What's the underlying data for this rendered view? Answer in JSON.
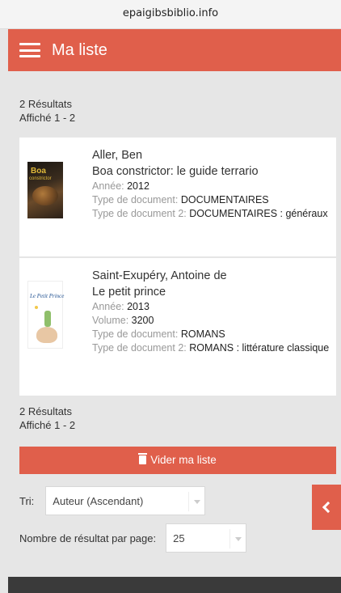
{
  "browser": {
    "url": "epaigibsbiblio.info"
  },
  "header": {
    "title": "Ma liste"
  },
  "results": {
    "count": "2 Résultats",
    "shown": "Affiché 1 - 2"
  },
  "items": [
    {
      "author": "Aller, Ben",
      "title": "Boa constrictor: le guide terrario",
      "annee_label": "Année:",
      "annee": "2012",
      "type_label": "Type de document:",
      "type": "DOCUMENTAIRES",
      "type2_label": "Type de document 2:",
      "type2": "DOCUMENTAIRES : généraux",
      "cover_t1": "Boa",
      "cover_t2": "constrictor"
    },
    {
      "author": "Saint-Exupéry, Antoine de",
      "title": "Le petit prince",
      "annee_label": "Année:",
      "annee": "2013",
      "volume_label": "Volume:",
      "volume": "3200",
      "type_label": "Type de document:",
      "type": "ROMANS",
      "type2_label": "Type de document 2:",
      "type2": "ROMANS : littérature classique",
      "cover_t1": "Le Petit Prince"
    }
  ],
  "actions": {
    "clear_label": "Vider ma liste"
  },
  "sort": {
    "label": "Tri:",
    "value": "Auteur (Ascendant)"
  },
  "per_page": {
    "label": "Nombre de résultat par page:",
    "value": "25"
  },
  "colors": {
    "accent": "#e05f4b",
    "background": "#e6e6e6"
  }
}
